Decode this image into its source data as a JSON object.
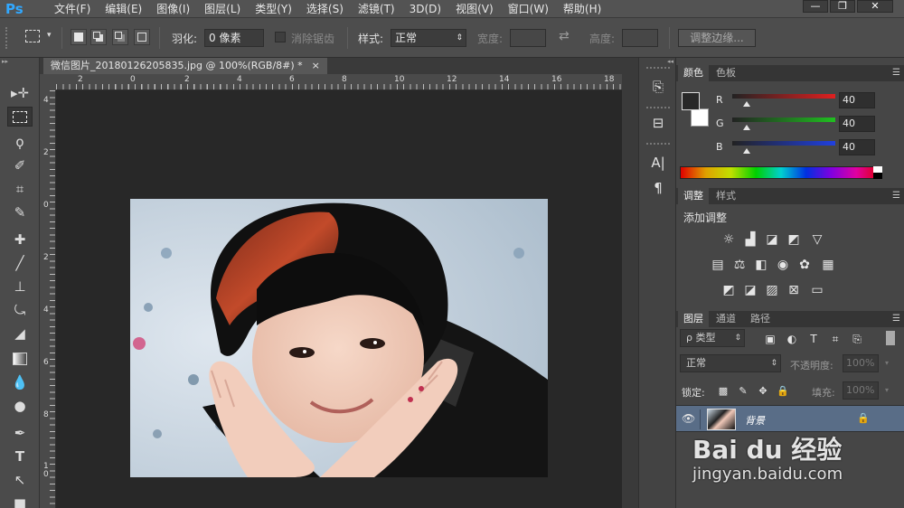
{
  "app": {
    "logo": "Ps"
  },
  "menu": [
    "文件(F)",
    "编辑(E)",
    "图像(I)",
    "图层(L)",
    "类型(Y)",
    "选择(S)",
    "滤镜(T)",
    "3D(D)",
    "视图(V)",
    "窗口(W)",
    "帮助(H)"
  ],
  "window_controls": {
    "minimize": "—",
    "maximize": "❐",
    "close": "✕"
  },
  "options": {
    "feather_label": "羽化:",
    "feather_value": "0 像素",
    "antialias_label": "消除锯齿",
    "style_label": "样式:",
    "style_value": "正常",
    "width_label": "宽度:",
    "height_label": "高度:",
    "refine_edge": "调整边缘..."
  },
  "document": {
    "tab_title": "微信图片_20180126205835.jpg @ 100%(RGB/8#) *",
    "close": "×"
  },
  "ruler": {
    "top_ticks": [
      "2",
      "0",
      "2",
      "4",
      "6",
      "8",
      "10",
      "12",
      "14",
      "16",
      "18"
    ],
    "left_ticks": [
      "4",
      "2",
      "0",
      "2",
      "4",
      "6",
      "8",
      "1\n0"
    ]
  },
  "color_panel": {
    "tabs": [
      "颜色",
      "色板"
    ],
    "channels": [
      {
        "label": "R",
        "value": "40"
      },
      {
        "label": "G",
        "value": "40"
      },
      {
        "label": "B",
        "value": "40"
      }
    ],
    "foreground": "#282828",
    "background": "#ffffff"
  },
  "adjust_panel": {
    "tabs": [
      "调整",
      "样式"
    ],
    "title": "添加调整"
  },
  "layers_panel": {
    "tabs": [
      "图层",
      "通道",
      "路径"
    ],
    "filter_label": "ρ 类型",
    "blend_mode": "正常",
    "opacity_label": "不透明度:",
    "opacity_value": "100%",
    "lock_label": "锁定:",
    "fill_label": "填充:",
    "fill_value": "100%",
    "layer_name": "背景"
  },
  "watermark": {
    "logo_text": "Bai du 经验",
    "url": "jingyan.baidu.com"
  }
}
